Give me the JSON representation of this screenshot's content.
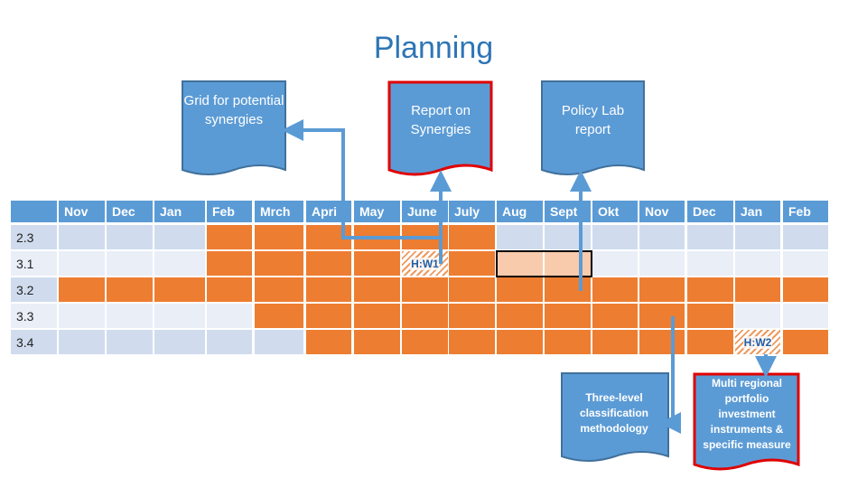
{
  "title": "Planning",
  "months": [
    "Nov",
    "Dec",
    "Jan",
    "Feb",
    "Mrch",
    "Apri",
    "May",
    "June",
    "July",
    "Aug",
    "Sept",
    "Okt",
    "Nov",
    "Dec",
    "Jan",
    "Feb"
  ],
  "rows": [
    {
      "label": "2.3",
      "cells": [
        "L",
        "L",
        "L",
        "O",
        "O",
        "O",
        "O",
        "O",
        "O",
        "L",
        "L",
        "L",
        "L",
        "L",
        "L",
        "L"
      ]
    },
    {
      "label": "3.1",
      "cells": [
        "L",
        "L",
        "L",
        "O",
        "O",
        "O",
        "O",
        "H:W1",
        "O",
        "P",
        "P",
        "L",
        "L",
        "L",
        "L",
        "L"
      ]
    },
    {
      "label": "3.2",
      "cells": [
        "O",
        "O",
        "O",
        "O",
        "O",
        "O",
        "O",
        "O",
        "O",
        "O",
        "O",
        "O",
        "O",
        "O",
        "O",
        "O"
      ]
    },
    {
      "label": "3.3",
      "cells": [
        "L",
        "L",
        "L",
        "L",
        "O",
        "O",
        "O",
        "O",
        "O",
        "O",
        "O",
        "O",
        "O",
        "O",
        "L",
        "L"
      ]
    },
    {
      "label": "3.4",
      "cells": [
        "L",
        "L",
        "L",
        "L",
        "L",
        "O",
        "O",
        "O",
        "O",
        "O",
        "O",
        "O",
        "O",
        "O",
        "H:W2",
        "O"
      ]
    }
  ],
  "callouts": {
    "grid": "Grid for potential synergies",
    "report": "Report on Synergies",
    "policy": "Policy Lab report",
    "three_level": "Three-level classification methodology",
    "multi": "Multi regional portfolio investment instruments & specific measure"
  },
  "colors": {
    "header": "#5b9bd5",
    "active": "#ed7d31",
    "inactive": "#d0dcee",
    "highlight": "#f8cbad",
    "callout": "#5b9bd5",
    "emphasis_border": "#e00000"
  }
}
